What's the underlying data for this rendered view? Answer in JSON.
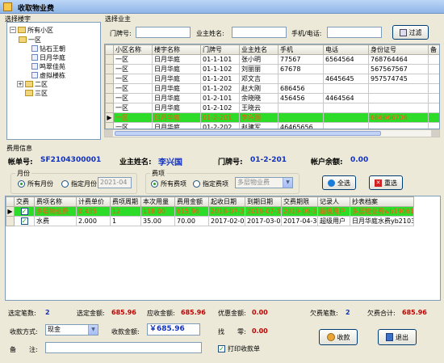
{
  "window": {
    "title": "收取物业费"
  },
  "tree": {
    "section_title": "选择楼宇",
    "items": [
      {
        "label": "所有小区"
      },
      {
        "label": "一区"
      },
      {
        "label": "钻石王朝"
      },
      {
        "label": "日月华庭"
      },
      {
        "label": "鸣翠佳苑"
      },
      {
        "label": "虚拟楼栋"
      },
      {
        "label": "二区"
      },
      {
        "label": "三区"
      }
    ]
  },
  "owner": {
    "section_title": "选择业主",
    "door_label": "门牌号:",
    "name_label": "业主姓名:",
    "phone_label": "手机/电话:",
    "door_value": "",
    "name_value": "",
    "phone_value": "",
    "filter_button": "过滤",
    "columns": [
      "小区名称",
      "楼宇名称",
      "门牌号",
      "业主姓名",
      "手机",
      "电话",
      "身份证号",
      "备"
    ],
    "rows": [
      [
        "一区",
        "日月华庭",
        "01-1-101",
        "张小明",
        "77567",
        "6564564",
        "768764464",
        ""
      ],
      [
        "一区",
        "日月华庭",
        "01-1-102",
        "刘丽丽",
        "67678",
        "",
        "567567567",
        ""
      ],
      [
        "一区",
        "日月华庭",
        "01-1-201",
        "邓文吉",
        "",
        "4645645",
        "957574745",
        ""
      ],
      [
        "一区",
        "日月华庭",
        "01-1-202",
        "赵大刚",
        "686456",
        "",
        "",
        ""
      ],
      [
        "一区",
        "日月华庭",
        "01-2-101",
        "余晓晓",
        "456456",
        "4464564",
        "",
        ""
      ],
      [
        "一区",
        "日月华庭",
        "01-2-102",
        "王晓云",
        "",
        "",
        "",
        ""
      ],
      [
        "一区",
        "日月华庭",
        "01-2-201",
        "李兴国",
        "",
        "",
        "666666706",
        ""
      ],
      [
        "一区",
        "日月华庭",
        "01-2-202",
        "赵建军",
        "46465656",
        "",
        "",
        ""
      ]
    ]
  },
  "fee": {
    "section_title": "费用信息",
    "account_label": "帐单号:",
    "account_value": "SF2104300001",
    "owner_label": "业主姓名:",
    "owner_value": "李兴国",
    "door_label": "门牌号:",
    "door_value": "01-2-201",
    "balance_label": "帐户余额:",
    "balance_value": "0.00",
    "month_group": "月份",
    "month_all": "所有月份",
    "month_specific": "指定月份",
    "month_value": "2021-04",
    "item_group": "费项",
    "item_all": "所有费项",
    "item_specific": "指定费项",
    "item_value": "多层物业费",
    "select_all_button": "全选",
    "reselect_button": "重选",
    "columns": [
      "交费",
      "费项名称",
      "计费单价",
      "费项周期",
      "本次用量",
      "费用金额",
      "起收日期",
      "到期日期",
      "交费期限",
      "记录人",
      "抄表档案"
    ],
    "rows": [
      [
        "",
        "多层物业费",
        "0.435",
        "12",
        "118.00",
        "615.96",
        "2018-07-31",
        "2019-07-31",
        "2019-09-30",
        "超级用户",
        "多层物业费wb190610"
      ],
      [
        "",
        "水费",
        "2.000",
        "1",
        "35.00",
        "70.00",
        "2017-02-06",
        "2017-03-06",
        "2017-04-30",
        "超级用户",
        "日月华庭水费yb210310"
      ]
    ]
  },
  "summary": {
    "selected_count_label": "选定笔数:",
    "selected_count": "2",
    "selected_amount_label": "选定金额:",
    "selected_amount": "685.96",
    "receivable_label": "应收金额:",
    "receivable": "685.96",
    "discount_label": "优惠金额:",
    "discount": "0.00",
    "owed_count_label": "欠费笔数:",
    "owed_count": "2",
    "owed_total_label": "欠费合计:",
    "owed_total": "685.96",
    "pay_method_label": "收款方式:",
    "pay_method": "现金",
    "received_label": "收款金额:",
    "received": "￥685.96",
    "change_label": "找　　零:",
    "change": "0.00",
    "note_label": "备　　注:",
    "note_value": "",
    "print_receipt": "打印收款单",
    "collect_button": "收款",
    "exit_button": "退出"
  },
  "colors": {
    "selected_row": "#2cdc28",
    "selected_text": "#ff5010",
    "value_blue": "#1030c0",
    "value_red": "#c00000"
  }
}
